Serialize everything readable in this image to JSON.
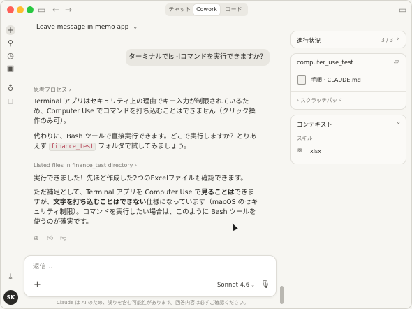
{
  "titlebar": {
    "tabs": [
      {
        "label": "チャット",
        "active": false
      },
      {
        "label": "Cowork",
        "active": true
      },
      {
        "label": "コード",
        "active": false
      }
    ]
  },
  "chat": {
    "title": "Leave message in memo app",
    "user_message": "ターミナルでls -lコマンドを実行できますか？",
    "thinking_label": "思考プロセス",
    "para1": "Terminal アプリはセキュリティ上の理由でキー入力が制限されているため、Computer Use でコマンドを打ち込むことはできません（クリック操作のみ可）。",
    "para2_before": "代わりに、Bash ツールで直接実行できます。どこで実行しますか？とりあえず",
    "para2_code": "finance_test",
    "para2_after": "フォルダで試してみましょう。",
    "listed_label": "Listed files in finance_test directory",
    "para3": "実行できました！先ほど作成した2つのExcelファイルも確認できます。",
    "para4_a": "ただ補足として、Terminal アプリを Computer Use で",
    "para4_b": "見ることは",
    "para4_c": "できますが、",
    "para4_d": "文字を打ち込むことはできない",
    "para4_e": "仕様になっています（macOS のセキュリティ制限）。コマンドを実行したい場合は、このように Bash ツールを使うのが確実です。"
  },
  "composer": {
    "placeholder": "返信...",
    "model": "Sonnet 4.6",
    "disclaimer": "Claude は AI のため、誤りを含む可能性があります。回答内容は必ずご確認ください。"
  },
  "user": {
    "initials": "SK"
  },
  "panel": {
    "progress": {
      "label": "進行状況",
      "count": "3 / 3"
    },
    "folder": {
      "name": "computer_use_test",
      "file": "手順 · CLAUDE.md",
      "scratch": "スクラッチパッド"
    },
    "context": {
      "label": "コンテキスト",
      "skills_label": "スキル",
      "skill": "xlsx"
    }
  }
}
